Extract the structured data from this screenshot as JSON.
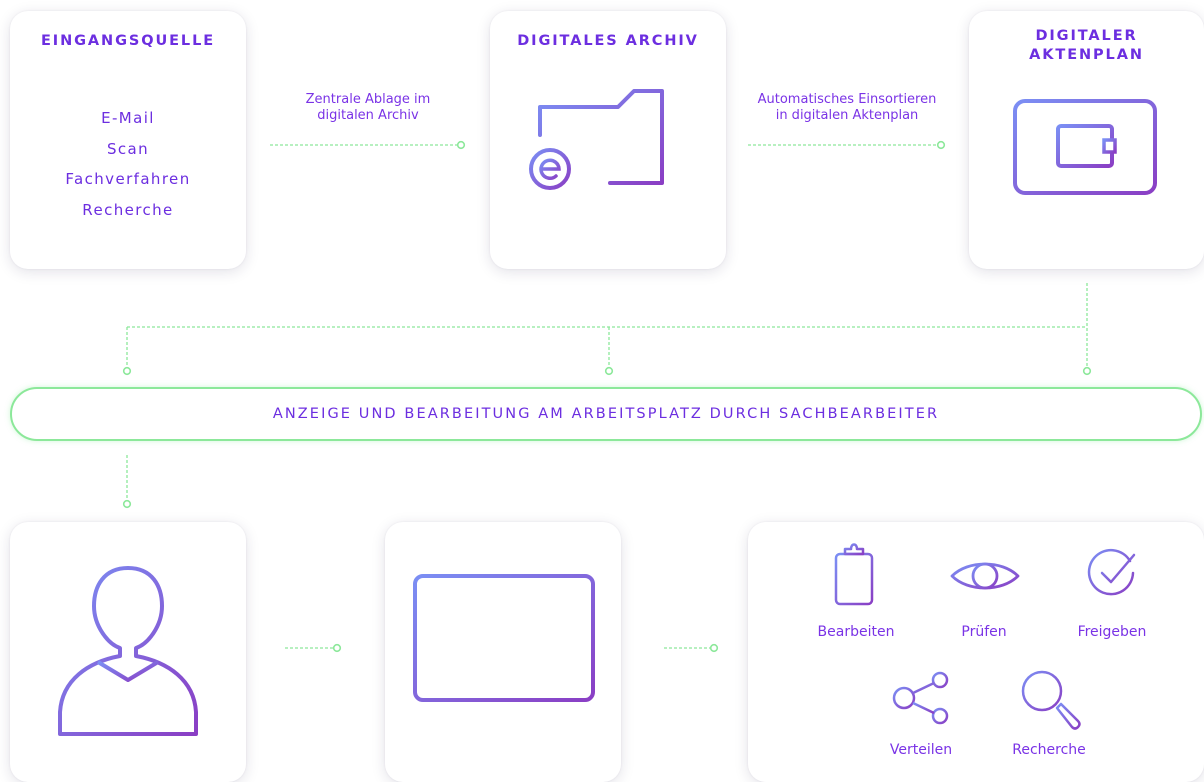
{
  "source": {
    "title": "EINGANGSQUELLE",
    "items": [
      "E-Mail",
      "Scan",
      "Fachverfahren",
      "Recherche"
    ]
  },
  "archive": {
    "title": "DIGITALES ARCHIV"
  },
  "aktenplan": {
    "title": "DIGITALER\nAKTENPLAN"
  },
  "flow_labels": {
    "to_archive": "Zentrale Ablage im\ndigitalen Archiv",
    "to_aktenplan": "Automatisches Einsortieren\nin digitalen Aktenplan"
  },
  "banner": {
    "text": "ANZEIGE UND BEARBEITUNG AM ARBEITSPLATZ DURCH SACHBEARBEITER"
  },
  "actions": [
    {
      "label": "Bearbeiten",
      "icon": "clipboard-icon"
    },
    {
      "label": "Prüfen",
      "icon": "eye-icon"
    },
    {
      "label": "Freigeben",
      "icon": "check-circle-icon"
    },
    {
      "label": "Verteilen",
      "icon": "share-icon"
    },
    {
      "label": "Recherche",
      "icon": "magnifier-plus-icon"
    }
  ],
  "bottom_icons": [
    "user-icon",
    "monitor-icon"
  ],
  "colors": {
    "accent": "#6c2ee0",
    "gradient_start": "#7b8ff4",
    "gradient_end": "#8a3ec4",
    "connector": "#8ce89a"
  }
}
